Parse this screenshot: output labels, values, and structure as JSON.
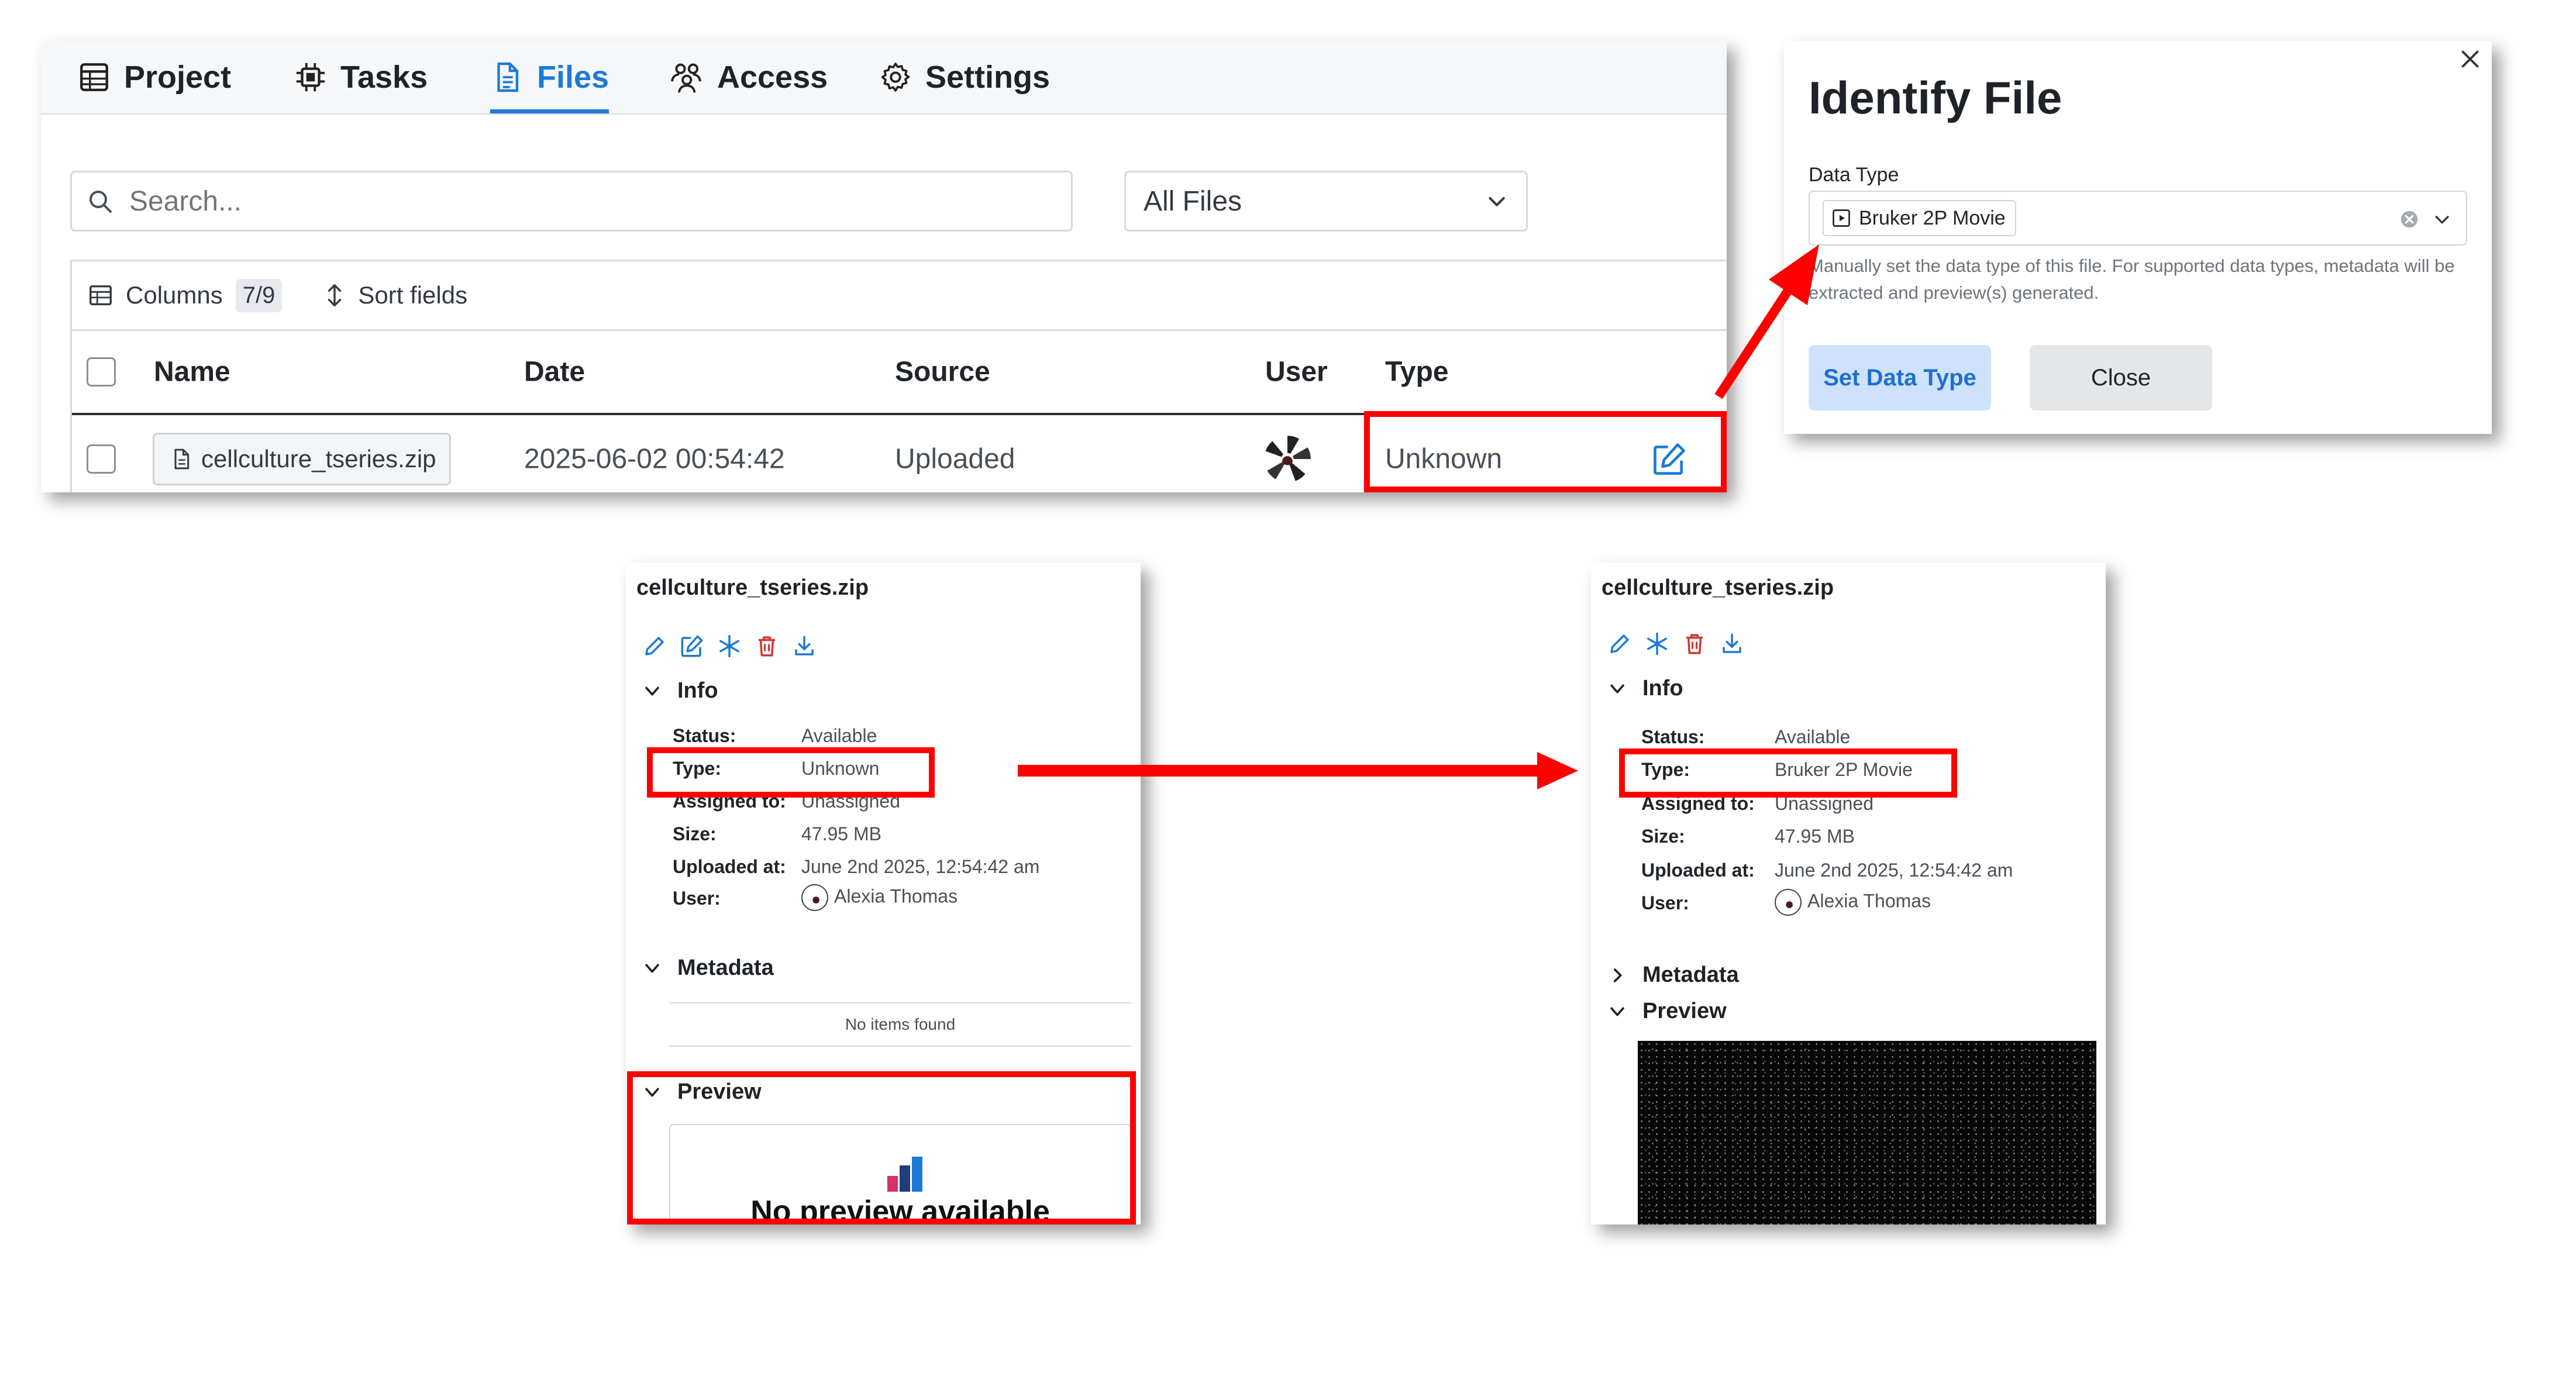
{
  "tabs": [
    {
      "label": "Project",
      "icon": "table-icon",
      "active": false
    },
    {
      "label": "Tasks",
      "icon": "chip-icon",
      "active": false
    },
    {
      "label": "Files",
      "icon": "document-icon",
      "active": true
    },
    {
      "label": "Access",
      "icon": "users-icon",
      "active": false
    },
    {
      "label": "Settings",
      "icon": "gear-icon",
      "active": false
    }
  ],
  "search": {
    "placeholder": "Search..."
  },
  "filter": {
    "selected": "All Files"
  },
  "table_toolbar": {
    "columns_label": "Columns",
    "columns_count": "7/9",
    "sort_label": "Sort fields"
  },
  "table": {
    "columns": [
      "Name",
      "Date",
      "Source",
      "User",
      "Type"
    ],
    "rows": [
      {
        "name": "cellculture_tseries.zip",
        "date": "2025-06-02 00:54:42",
        "source": "Uploaded",
        "user": "avatar",
        "type": "Unknown"
      }
    ]
  },
  "dialog": {
    "title": "Identify File",
    "field_label": "Data Type",
    "selected_type": "Bruker 2P Movie",
    "help_text": "Manually set the data type of this file. For supported data types, metadata will be extracted and preview(s) generated.",
    "primary_button": "Set Data Type",
    "secondary_button": "Close"
  },
  "detail_before": {
    "title": "cellculture_tseries.zip",
    "info_label": "Info",
    "fields": [
      {
        "key": "Status:",
        "value": "Available"
      },
      {
        "key": "Type:",
        "value": "Unknown"
      },
      {
        "key": "Assigned to:",
        "value": "Unassigned"
      },
      {
        "key": "Size:",
        "value": "47.95 MB"
      },
      {
        "key": "Uploaded at:",
        "value": "June 2nd 2025, 12:54:42 am"
      },
      {
        "key": "User:",
        "value": "Alexia Thomas"
      }
    ],
    "metadata_label": "Metadata",
    "metadata_empty": "No items found",
    "preview_label": "Preview",
    "preview_empty": "No preview available"
  },
  "detail_after": {
    "title": "cellculture_tseries.zip",
    "info_label": "Info",
    "fields": [
      {
        "key": "Status:",
        "value": "Available"
      },
      {
        "key": "Type:",
        "value": "Bruker 2P Movie"
      },
      {
        "key": "Assigned to:",
        "value": "Unassigned"
      },
      {
        "key": "Size:",
        "value": "47.95 MB"
      },
      {
        "key": "Uploaded at:",
        "value": "June 2nd 2025, 12:54:42 am"
      },
      {
        "key": "User:",
        "value": "Alexia Thomas"
      }
    ],
    "metadata_label": "Metadata",
    "preview_label": "Preview"
  },
  "colors": {
    "accent": "#1d7ad6",
    "highlight": "#ff0000",
    "delete": "#d63333",
    "primary_button_bg": "#cfe2fb"
  }
}
